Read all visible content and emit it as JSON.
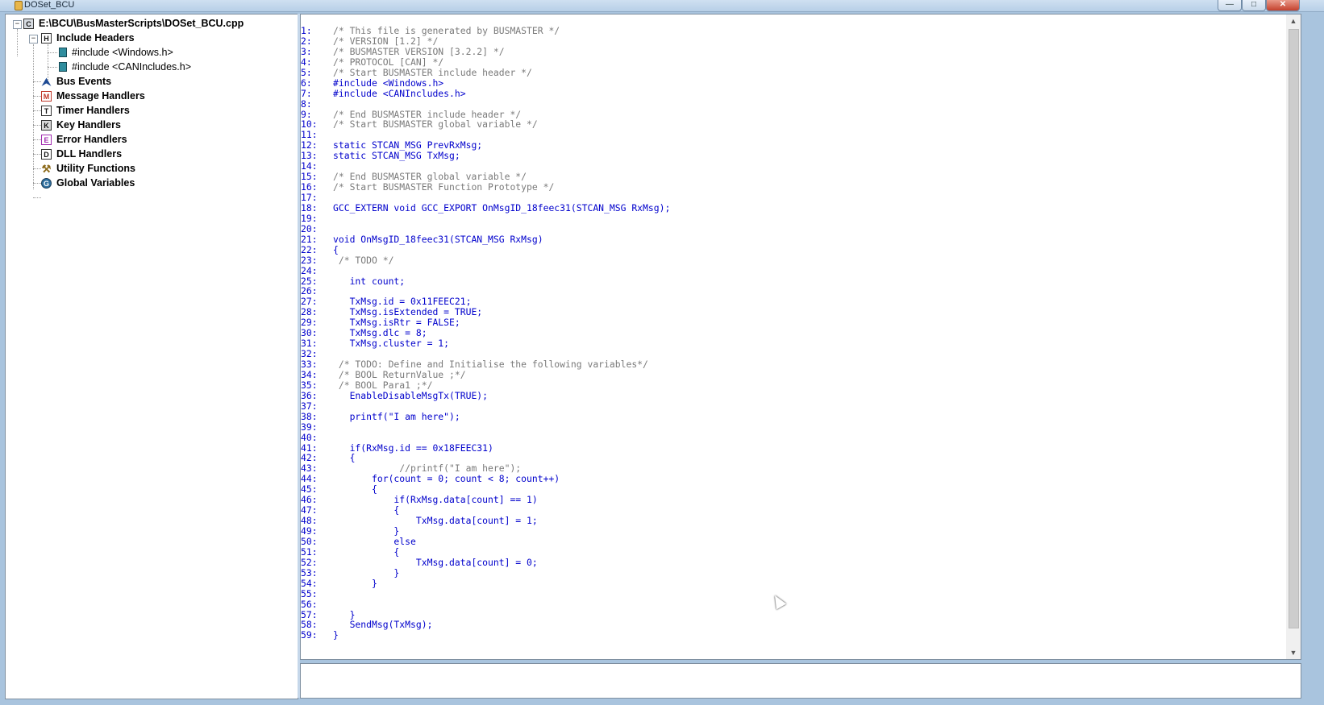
{
  "window": {
    "title": "DOSet_BCU",
    "buttons": {
      "minimize": "—",
      "maximize": "□",
      "close": "✕"
    }
  },
  "tree": {
    "root": "E:\\BCU\\BusMasterScripts\\DOSet_BCU.cpp",
    "include_headers": "Include Headers",
    "includes": [
      "#include <Windows.h>",
      "#include <CANIncludes.h>"
    ],
    "handlers": [
      {
        "label": "Bus Events",
        "icon": "bus-events-icon",
        "glyph": "⮝"
      },
      {
        "label": "Message Handlers",
        "icon": "message-handler-icon",
        "glyph": "M"
      },
      {
        "label": "Timer Handlers",
        "icon": "timer-handler-icon",
        "glyph": "T"
      },
      {
        "label": "Key Handlers",
        "icon": "key-handler-icon",
        "glyph": "K"
      },
      {
        "label": "Error Handlers",
        "icon": "error-handler-icon",
        "glyph": "E"
      },
      {
        "label": "DLL Handlers",
        "icon": "dll-handler-icon",
        "glyph": "D"
      },
      {
        "label": "Utility Functions",
        "icon": "utility-function-icon",
        "glyph": "⚒"
      },
      {
        "label": "Global Variables",
        "icon": "global-variable-icon",
        "glyph": "G"
      }
    ]
  },
  "code": {
    "lines": [
      {
        "n": "1:",
        "t": "/* This file is generated by BUSMASTER */",
        "c": true
      },
      {
        "n": "2:",
        "t": "/* VERSION [1.2] */",
        "c": true
      },
      {
        "n": "3:",
        "t": "/* BUSMASTER VERSION [3.2.2] */",
        "c": true
      },
      {
        "n": "4:",
        "t": "/* PROTOCOL [CAN] */",
        "c": true
      },
      {
        "n": "5:",
        "t": "/* Start BUSMASTER include header */",
        "c": true
      },
      {
        "n": "6:",
        "t": "#include <Windows.h>",
        "c": false
      },
      {
        "n": "7:",
        "t": "#include <CANIncludes.h>",
        "c": false
      },
      {
        "n": "8:",
        "t": "",
        "c": false
      },
      {
        "n": "9:",
        "t": "/* End BUSMASTER include header */",
        "c": true
      },
      {
        "n": "10:",
        "t": "/* Start BUSMASTER global variable */",
        "c": true
      },
      {
        "n": "11:",
        "t": "",
        "c": false
      },
      {
        "n": "12:",
        "t": "static STCAN_MSG PrevRxMsg;",
        "c": false
      },
      {
        "n": "13:",
        "t": "static STCAN_MSG TxMsg;",
        "c": false
      },
      {
        "n": "14:",
        "t": "",
        "c": false
      },
      {
        "n": "15:",
        "t": "/* End BUSMASTER global variable */",
        "c": true
      },
      {
        "n": "16:",
        "t": "/* Start BUSMASTER Function Prototype */",
        "c": true
      },
      {
        "n": "17:",
        "t": "",
        "c": false
      },
      {
        "n": "18:",
        "t": "GCC_EXTERN void GCC_EXPORT OnMsgID_18feec31(STCAN_MSG RxMsg);",
        "c": false
      },
      {
        "n": "19:",
        "t": "",
        "c": false
      },
      {
        "n": "20:",
        "t": "",
        "c": false
      },
      {
        "n": "21:",
        "t": "void OnMsgID_18feec31(STCAN_MSG RxMsg)",
        "c": false
      },
      {
        "n": "22:",
        "t": "{",
        "c": false
      },
      {
        "n": "23:",
        "t": " /* TODO */",
        "c": true
      },
      {
        "n": "24:",
        "t": "",
        "c": false
      },
      {
        "n": "25:",
        "t": "   int count;",
        "c": false
      },
      {
        "n": "26:",
        "t": "",
        "c": false
      },
      {
        "n": "27:",
        "t": "   TxMsg.id = 0x11FEEC21;",
        "c": false
      },
      {
        "n": "28:",
        "t": "   TxMsg.isExtended = TRUE;",
        "c": false
      },
      {
        "n": "29:",
        "t": "   TxMsg.isRtr = FALSE;",
        "c": false
      },
      {
        "n": "30:",
        "t": "   TxMsg.dlc = 8;",
        "c": false
      },
      {
        "n": "31:",
        "t": "   TxMsg.cluster = 1;",
        "c": false
      },
      {
        "n": "32:",
        "t": "",
        "c": false
      },
      {
        "n": "33:",
        "t": " /* TODO: Define and Initialise the following variables*/",
        "c": true
      },
      {
        "n": "34:",
        "t": " /* BOOL ReturnValue ;*/",
        "c": true
      },
      {
        "n": "35:",
        "t": " /* BOOL Para1 ;*/",
        "c": true
      },
      {
        "n": "36:",
        "t": "   EnableDisableMsgTx(TRUE);",
        "c": false
      },
      {
        "n": "37:",
        "t": "",
        "c": false
      },
      {
        "n": "38:",
        "t": "   printf(\"I am here\");",
        "c": false
      },
      {
        "n": "39:",
        "t": "",
        "c": false
      },
      {
        "n": "40:",
        "t": "",
        "c": false
      },
      {
        "n": "41:",
        "t": "   if(RxMsg.id == 0x18FEEC31)",
        "c": false
      },
      {
        "n": "42:",
        "t": "   {",
        "c": false
      },
      {
        "n": "43:",
        "t": "            //printf(\"I am here\");",
        "c": true
      },
      {
        "n": "44:",
        "t": "       for(count = 0; count < 8; count++)",
        "c": false
      },
      {
        "n": "45:",
        "t": "       {",
        "c": false
      },
      {
        "n": "46:",
        "t": "           if(RxMsg.data[count] == 1)",
        "c": false
      },
      {
        "n": "47:",
        "t": "           {",
        "c": false
      },
      {
        "n": "48:",
        "t": "               TxMsg.data[count] = 1;",
        "c": false
      },
      {
        "n": "49:",
        "t": "           }",
        "c": false
      },
      {
        "n": "50:",
        "t": "           else",
        "c": false
      },
      {
        "n": "51:",
        "t": "           {",
        "c": false
      },
      {
        "n": "52:",
        "t": "               TxMsg.data[count] = 0;",
        "c": false
      },
      {
        "n": "53:",
        "t": "           }",
        "c": false
      },
      {
        "n": "54:",
        "t": "       }",
        "c": false
      },
      {
        "n": "55:",
        "t": "",
        "c": false
      },
      {
        "n": "56:",
        "t": "",
        "c": false
      },
      {
        "n": "57:",
        "t": "   }",
        "c": false
      },
      {
        "n": "58:",
        "t": "   SendMsg(TxMsg);",
        "c": false
      },
      {
        "n": "59:",
        "t": "}",
        "c": false
      }
    ]
  },
  "colors": {
    "code": "#0000cc",
    "comment": "#7a7a7a"
  }
}
